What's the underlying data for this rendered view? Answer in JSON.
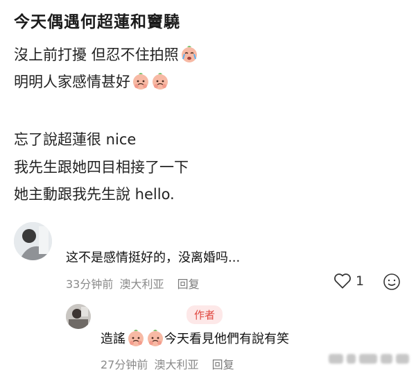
{
  "post": {
    "title": "今天偶遇何超蓮和竇驍",
    "line1": "沒上前打擾 但忍不住拍照",
    "line2": "明明人家感情甚好",
    "line3": "忘了說超蓮很 nice",
    "line4": "我先生跟她四目相接了一下",
    "line5": "她主動跟我先生說 hello."
  },
  "comment1": {
    "text": "这不是感情挺好的，没离婚吗...",
    "time": "33分钟前",
    "location": "澳大利亚",
    "reply_label": "回复",
    "like_count": "1"
  },
  "reply1": {
    "badge": "作者",
    "prefix": "造謠",
    "suffix": " 今天看見他們有說有笑",
    "time": "27分钟前",
    "location": "澳大利亚",
    "reply_label": "回复"
  },
  "icons": {
    "crying_emoji": "crying-face-emoji",
    "pleading_emoji": "pleading-face-emoji",
    "heart": "heart-icon",
    "emoji_button": "smiley-icon"
  },
  "colors": {
    "badge_bg": "#fde8e8",
    "badge_text": "#e0473f",
    "meta_text": "#8a8a8a"
  }
}
